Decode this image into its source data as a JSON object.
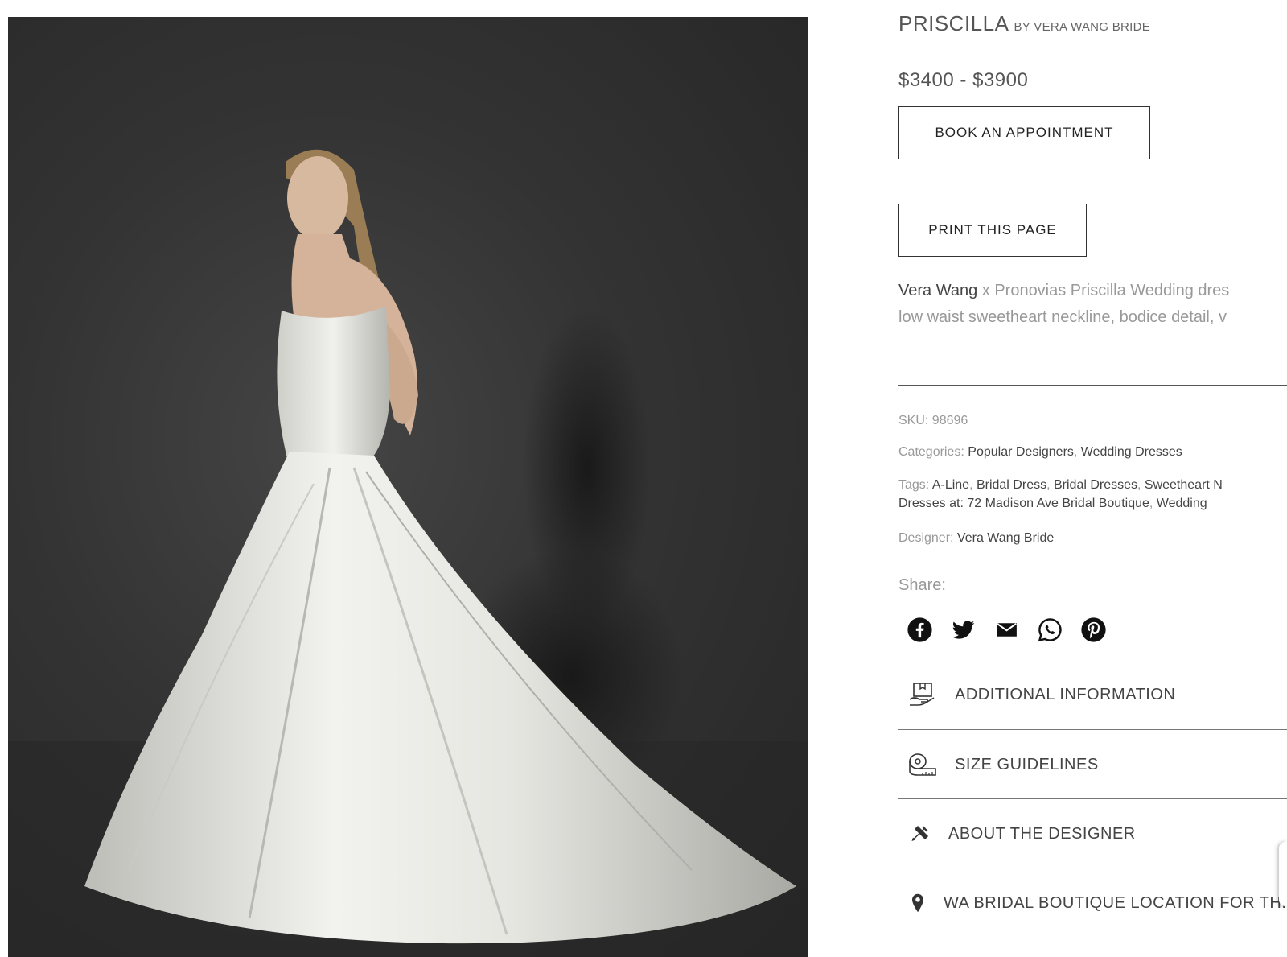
{
  "product": {
    "title": "PRISCILLA",
    "by": "BY VERA WANG BRIDE",
    "price": "$3400 - $3900",
    "image_alt": "model wearing strapless white satin ball gown, back view"
  },
  "buttons": {
    "book": "BOOK AN APPOINTMENT",
    "print": "PRINT THIS PAGE"
  },
  "description": {
    "brand": "Vera Wang",
    "line1_rest": " x Pronovias Priscilla Wedding dres",
    "line2": "low waist sweetheart neckline, bodice detail, v"
  },
  "meta": {
    "sku_label": "SKU: ",
    "sku_value": "98696",
    "categories_label": "Categories: ",
    "categories": [
      "Popular Designers",
      "Wedding Dresses"
    ],
    "tags_label": "Tags: ",
    "tags_line1": [
      "A-Line",
      "Bridal Dress",
      "Bridal Dresses",
      "Sweetheart N"
    ],
    "tags_line2": [
      "Dresses at: 72 Madison Ave Bridal Boutique",
      "Wedding"
    ],
    "designer_label": "Designer: ",
    "designer_value": "Vera Wang Bride"
  },
  "share": {
    "label": "Share:",
    "icons": [
      "facebook-icon",
      "twitter-icon",
      "email-icon",
      "whatsapp-icon",
      "pinterest-icon"
    ]
  },
  "accordion": [
    {
      "label": "ADDITIONAL INFORMATION",
      "icon": "info-box-icon"
    },
    {
      "label": "SIZE GUIDELINES",
      "icon": "measuring-tape-icon"
    },
    {
      "label": "ABOUT THE DESIGNER",
      "icon": "designer-tools-icon"
    },
    {
      "label": "WA BRIDAL BOUTIQUE LOCATION FOR THIS",
      "icon": "location-pin-icon"
    }
  ]
}
